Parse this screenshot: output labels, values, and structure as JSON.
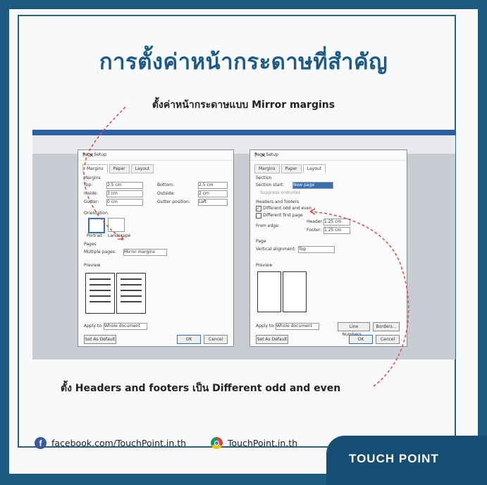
{
  "title": "การตั้งค่าหน้ากระดาษที่สำคัญ",
  "subtitle": "ตั้งค่าหน้ากระดาษแบบ Mirror margins",
  "bottom_caption": "ตั้ง Headers and footers เป็น Different odd and even",
  "footer": {
    "facebook": "facebook.com/TouchPoint.in.th",
    "website": "TouchPoint.in.th"
  },
  "logo": "TOUCH POINT",
  "dialog_left": {
    "title": "Page Setup",
    "tabs": [
      "Margins",
      "Paper",
      "Layout"
    ],
    "margins_label": "Margins",
    "fields": [
      {
        "label": "Top:",
        "value": "2.5 cm",
        "label2": "Bottom:",
        "value2": "2.5 cm"
      },
      {
        "label": "Inside:",
        "value": "3 cm",
        "label2": "Outside:",
        "value2": "2 cm"
      },
      {
        "label": "Gutter:",
        "value": "0 cm",
        "label2": "Gutter position:",
        "value2": "Left"
      }
    ],
    "orientation_label": "Orientation",
    "portrait": "Portrait",
    "landscape": "Landscape",
    "pages_label": "Pages",
    "multiple_pages_label": "Multiple pages:",
    "multiple_pages_value": "Mirror margins",
    "preview_label": "Preview",
    "apply_label": "Apply to:",
    "apply_value": "Whole document",
    "default_button": "Set As Default",
    "ok_button": "OK",
    "cancel_button": "Cancel"
  },
  "dialog_right": {
    "title": "Page Setup",
    "tabs": [
      "Margins",
      "Paper",
      "Layout"
    ],
    "section_label": "Section",
    "section_start_label": "Section start:",
    "section_start_value": "New page",
    "suppress_label": "Suppress endnotes",
    "hf_label": "Headers and footers",
    "diff_odd_even": "Different odd and even",
    "diff_first": "Different first page",
    "from_edge": "From edge:",
    "header_label": "Header:",
    "header_value": "1.25 cm",
    "footer_label": "Footer:",
    "footer_value": "1.25 cm",
    "page_label": "Page",
    "valign_label": "Vertical alignment:",
    "valign_value": "Top",
    "preview_label": "Preview",
    "apply_label": "Apply to:",
    "apply_value": "Whole document",
    "line_numbers": "Line Numbers...",
    "borders": "Borders...",
    "default_button": "Set As Default",
    "ok_button": "OK",
    "cancel_button": "Cancel"
  },
  "colors": {
    "border": "#1c5a80",
    "title": "#1e5a86",
    "arrow": "#d9534f"
  }
}
